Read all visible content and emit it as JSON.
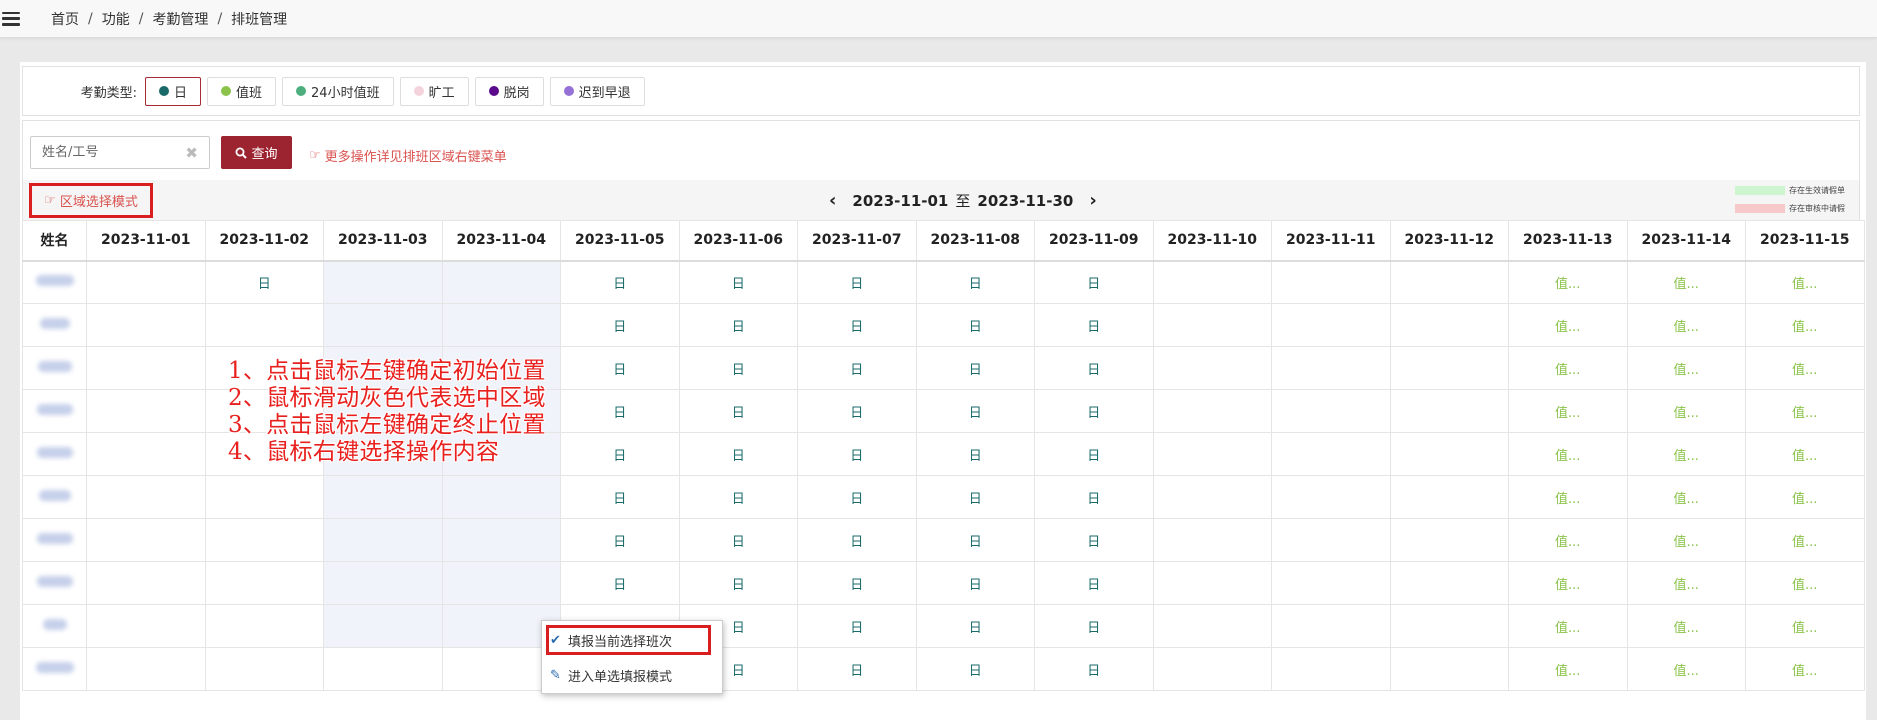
{
  "breadcrumb": [
    "首页",
    "功能",
    "考勤管理",
    "排班管理"
  ],
  "attendance_types": {
    "label": "考勤类型:",
    "items": [
      {
        "label": "日",
        "color": "#1a6a6a",
        "active": true
      },
      {
        "label": "值班",
        "color": "#8bc34a"
      },
      {
        "label": "24小时值班",
        "color": "#4caf7d"
      },
      {
        "label": "旷工",
        "color": "#f4d3dc"
      },
      {
        "label": "脱岗",
        "color": "#5b0a8c"
      },
      {
        "label": "迟到早退",
        "color": "#9570d6"
      }
    ]
  },
  "search": {
    "placeholder": "姓名/工号",
    "button": "查询"
  },
  "hint": "更多操作详见排班区域右键菜单",
  "mode_button": "区域选择模式",
  "date_range": {
    "start": "2023-11-01",
    "sep": "至",
    "end": "2023-11-30"
  },
  "legend": [
    {
      "label": "存在生效请假单",
      "color": "#cdf5cf"
    },
    {
      "label": "存在审核中请假",
      "color": "#f8c9ca"
    }
  ],
  "table": {
    "name_header": "姓名",
    "dates": [
      "2023-11-01",
      "2023-11-02",
      "2023-11-03",
      "2023-11-04",
      "2023-11-05",
      "2023-11-06",
      "2023-11-07",
      "2023-11-08",
      "2023-11-09",
      "2023-11-10",
      "2023-11-11",
      "2023-11-12",
      "2023-11-13",
      "2023-11-14",
      "2023-11-15"
    ],
    "rows": [
      [
        "",
        "日",
        "",
        "",
        "日",
        "日",
        "日",
        "日",
        "日",
        "",
        "",
        "",
        "值...",
        "值...",
        "值..."
      ],
      [
        "",
        "",
        "",
        "",
        "日",
        "日",
        "日",
        "日",
        "日",
        "",
        "",
        "",
        "值...",
        "值...",
        "值..."
      ],
      [
        "",
        "",
        "",
        "",
        "日",
        "日",
        "日",
        "日",
        "日",
        "",
        "",
        "",
        "值...",
        "值...",
        "值..."
      ],
      [
        "",
        "",
        "",
        "",
        "日",
        "日",
        "日",
        "日",
        "日",
        "",
        "",
        "",
        "值...",
        "值...",
        "值..."
      ],
      [
        "",
        "",
        "",
        "",
        "日",
        "日",
        "日",
        "日",
        "日",
        "",
        "",
        "",
        "值...",
        "值...",
        "值..."
      ],
      [
        "",
        "",
        "",
        "",
        "日",
        "日",
        "日",
        "日",
        "日",
        "",
        "",
        "",
        "值...",
        "值...",
        "值..."
      ],
      [
        "",
        "",
        "",
        "",
        "日",
        "日",
        "日",
        "日",
        "日",
        "",
        "",
        "",
        "值...",
        "值...",
        "值..."
      ],
      [
        "",
        "",
        "",
        "",
        "日",
        "日",
        "日",
        "日",
        "日",
        "",
        "",
        "",
        "值...",
        "值...",
        "值..."
      ],
      [
        "",
        "",
        "",
        "",
        "",
        "日",
        "日",
        "日",
        "日",
        "",
        "",
        "",
        "值...",
        "值...",
        "值..."
      ],
      [
        "",
        "",
        "",
        "",
        "",
        "日",
        "日",
        "日",
        "日",
        "",
        "",
        "",
        "值...",
        "值...",
        "值..."
      ]
    ]
  },
  "instructions": [
    "1、点击鼠标左键确定初始位置",
    "2、鼠标滑动灰色代表选中区域",
    "3、点击鼠标左键确定终止位置",
    "4、鼠标右键选择操作内容"
  ],
  "context_menu": {
    "items": [
      {
        "label": "填报当前选择班次",
        "icon": "check-icon"
      },
      {
        "label": "进入单选填报模式",
        "icon": "edit-icon"
      }
    ]
  }
}
